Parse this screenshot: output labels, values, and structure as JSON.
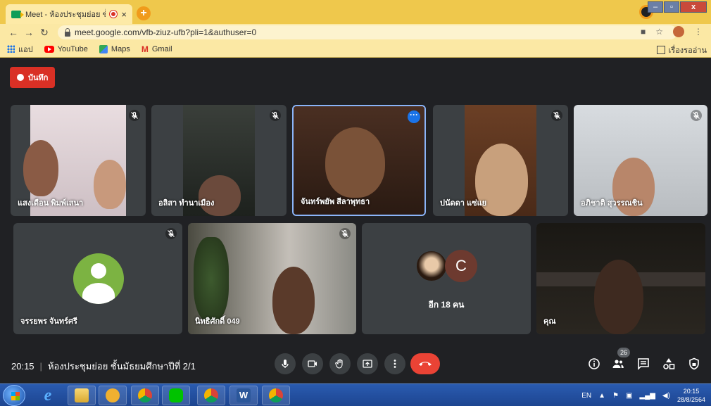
{
  "browser": {
    "tab_title": "Meet - ห้องประชุมย่อย ชั้นมัธยม",
    "tab_close": "×",
    "new_tab": "+",
    "url": "meet.google.com/vfb-ziuz-ufb?pli=1&authuser=0",
    "win_min": "–",
    "win_max": "▫",
    "win_close": "x"
  },
  "bookmarks": {
    "apps": "แอป",
    "youtube": "YouTube",
    "maps": "Maps",
    "gmail": "Gmail",
    "reading_list": "เรื่องรออ่าน"
  },
  "meet": {
    "record_label": "บันทึก",
    "participants": [
      {
        "name": "แสงเดือน พิมพ์เสนา",
        "muted": true
      },
      {
        "name": "อลิสา ทำนาเมือง",
        "muted": true
      },
      {
        "name": "จันทร์พยัพ สีลาพุทธา",
        "muted": false
      },
      {
        "name": "ปนัดดา แซ่แย",
        "muted": true
      },
      {
        "name": "อภิชาติ สุวรรณชิน",
        "muted": true
      },
      {
        "name": "จรรยพร จันทร์ศรี",
        "muted": true
      },
      {
        "name": "นิทธิศักดิ์ 049",
        "muted": true
      },
      {
        "name": "คุณ",
        "muted": false
      }
    ],
    "others_initial": "C",
    "others_label": "อีก 18 คน",
    "time": "20:15",
    "separator": "|",
    "meeting_title": "ห้องประชุมย่อย ชั้นมัธยมศึกษาปีที่ 2/1",
    "people_count": "26"
  },
  "taskbar": {
    "lang": "EN",
    "clock_time": "20:15",
    "clock_date": "28/8/2564"
  },
  "colors": {
    "record": "#d93025",
    "end_call": "#ea4335",
    "active_border": "#8ab4f8",
    "avatar_green": "#7cb342"
  }
}
